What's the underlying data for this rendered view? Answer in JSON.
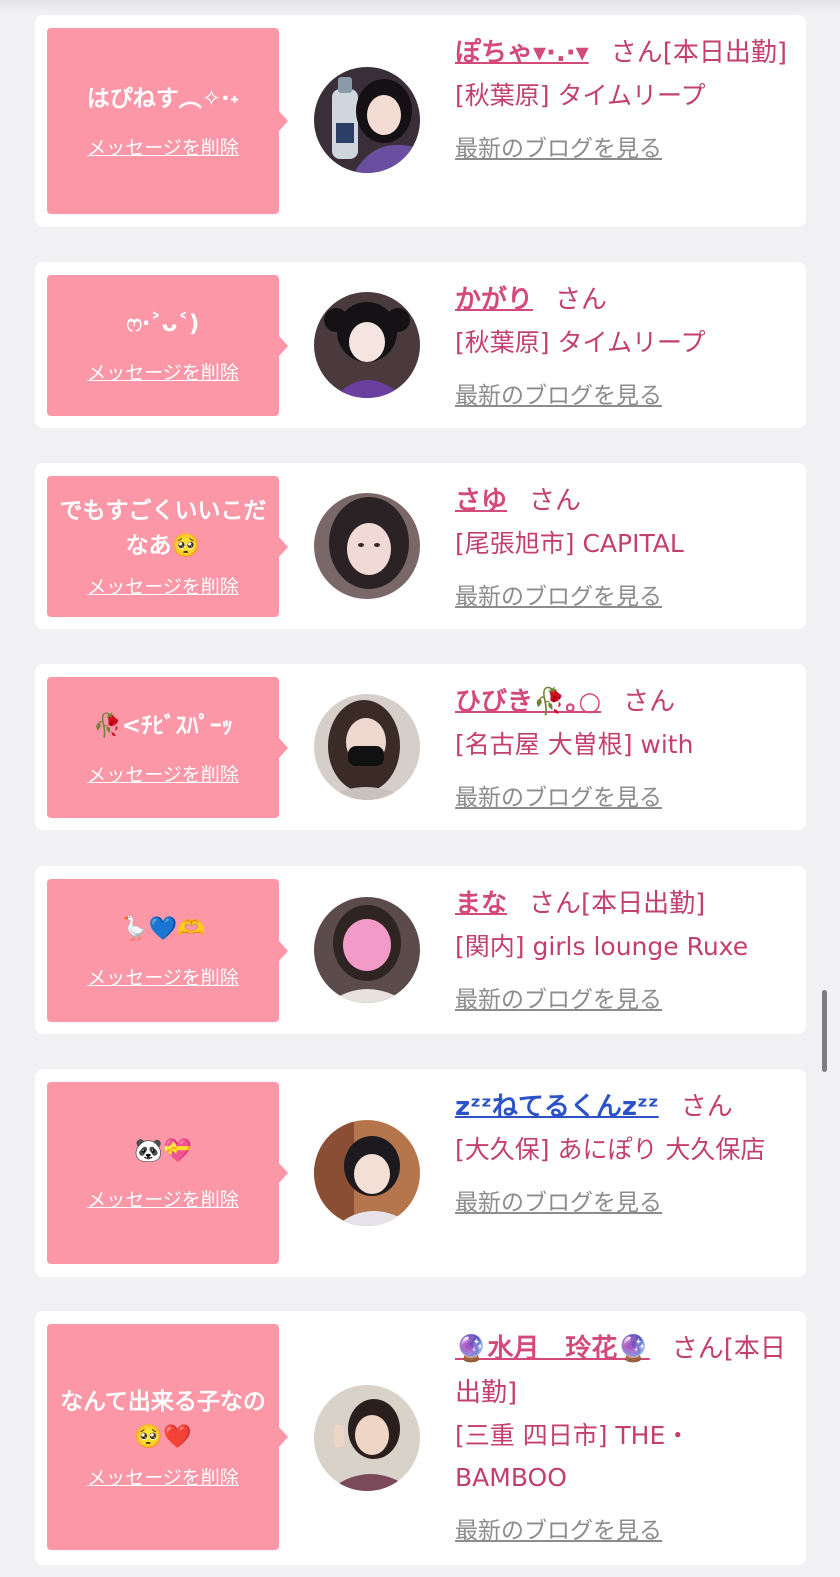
{
  "common": {
    "delete_label": "メッセージを削除",
    "blog_label": "最新のブログを見る",
    "san_label": "さん"
  },
  "cards": [
    {
      "message": "はぴねす︵✧·˖",
      "name": "ぽちゃ▾·.·▾",
      "status": "[本日出勤]",
      "shop": "[秋葉原] タイムリープ"
    },
    {
      "message": "ෆ‧˃ᴗ˂)",
      "name": "かがり",
      "status": "",
      "shop": "[秋葉原] タイムリープ"
    },
    {
      "message": "でもすごくいいこだなあ🥺",
      "name": "さゆ",
      "status": "",
      "shop": "[尾張旭市] CAPITAL"
    },
    {
      "message": "🥀<ﾁﾋﾞｽﾊﾟｰｯ",
      "name": "ひびき🥀｡○",
      "status": "",
      "shop": "[名古屋 大曽根] with"
    },
    {
      "message": "🪿💙🫶",
      "name": "まな",
      "status": "[本日出勤]",
      "shop": "[関内] girls lounge Ruxe"
    },
    {
      "message": "🐼💝",
      "name": "zᶻᶻねてるくんzᶻᶻ",
      "status": "",
      "shop": "[大久保] あにぽり 大久保店"
    },
    {
      "message": "なんて出来る子なの🥺❤️",
      "name": "🔮水月　玲花🔮",
      "status": "[本日出勤]",
      "shop": "[三重 四日市] THE・BAMBOO"
    }
  ],
  "colors": {
    "bubble": "#fc97a8",
    "name": "#d34a7a",
    "text": "#c33f6e",
    "link_gray": "#8c8c8c"
  }
}
